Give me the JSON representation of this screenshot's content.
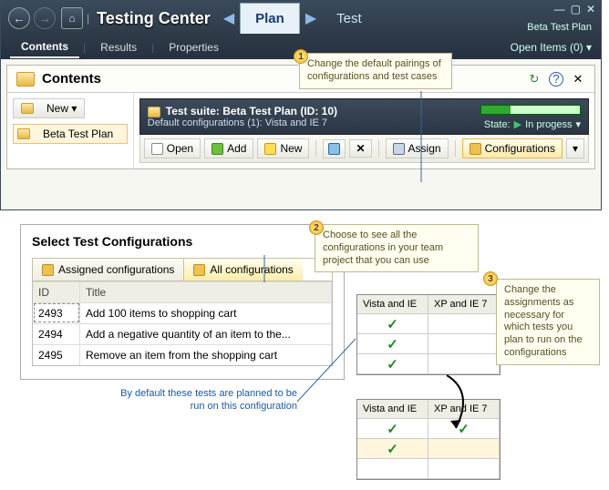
{
  "app_title": "Testing Center",
  "main_tabs": {
    "plan": "Plan",
    "test": "Test"
  },
  "header_plan_text": "Beta Test Plan",
  "window_buttons": {
    "min": "—",
    "max": "▢",
    "close": "✕"
  },
  "sub_tabs": {
    "contents": "Contents",
    "results": "Results",
    "properties": "Properties"
  },
  "open_items": "Open Items (0)  ▾",
  "content_panel": {
    "title": "Contents",
    "refresh_icon": "⟳",
    "help_icon": "?",
    "close_icon": "✕",
    "new_label": "New  ▾",
    "tree_item": "Beta Test Plan",
    "suite_title": "Test suite:  Beta Test Plan (ID: 10)",
    "suite_sub": "Default configurations (1): Vista and IE 7",
    "state_label": "State:",
    "state_value": "In progess",
    "toolbar": {
      "open": "Open",
      "add": "Add",
      "new": "New",
      "assign": "Assign",
      "config": "Configurations",
      "dd": "▾"
    }
  },
  "select_panel": {
    "title": "Select Test Configurations",
    "tab_assigned": "Assigned configurations",
    "tab_all": "All configurations",
    "col_id": "ID",
    "col_title": "Title",
    "rows": [
      {
        "id": "2493",
        "title": "Add 100 items to shopping cart"
      },
      {
        "id": "2494",
        "title": "Add a negative quantity of an item to the..."
      },
      {
        "id": "2495",
        "title": "Remove an item from the shopping cart"
      }
    ]
  },
  "grid_cols": {
    "c1": "Vista and IE",
    "c2": "XP and IE 7"
  },
  "callouts": {
    "c1": "Change the default pairings of configurations and test cases",
    "c2": "Choose to see all the configurations in your team project that you can use",
    "c3": "Change the assignments as necessary for which tests you plan to run on the configurations"
  },
  "note": "By default these tests are planned to be run on this configuration"
}
